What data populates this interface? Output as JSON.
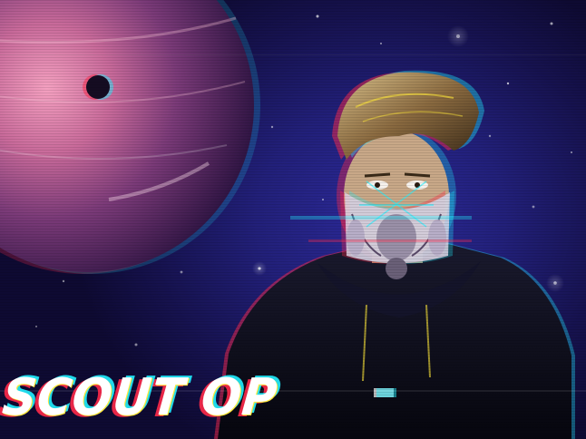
{
  "artwork": {
    "title_text": "SCOUT OP",
    "style": "glitch / chromatic aberration space portrait",
    "colors": {
      "background_deep": "#0e0a32",
      "background_mid": "#22207a",
      "planet_pink": "#e07aa8",
      "planet_shadow": "#3a1a5a",
      "glitch_red": "#ff2a4a",
      "glitch_cyan": "#22f0ff",
      "glitch_yellow": "#ffe83a",
      "hoodie_dark": "#0c0c1a",
      "skin_tone": "#c8a888",
      "hair": "#8a6a40"
    },
    "icons": [
      "planet-icon",
      "moon-icon",
      "masked-person-figure",
      "stars"
    ]
  }
}
